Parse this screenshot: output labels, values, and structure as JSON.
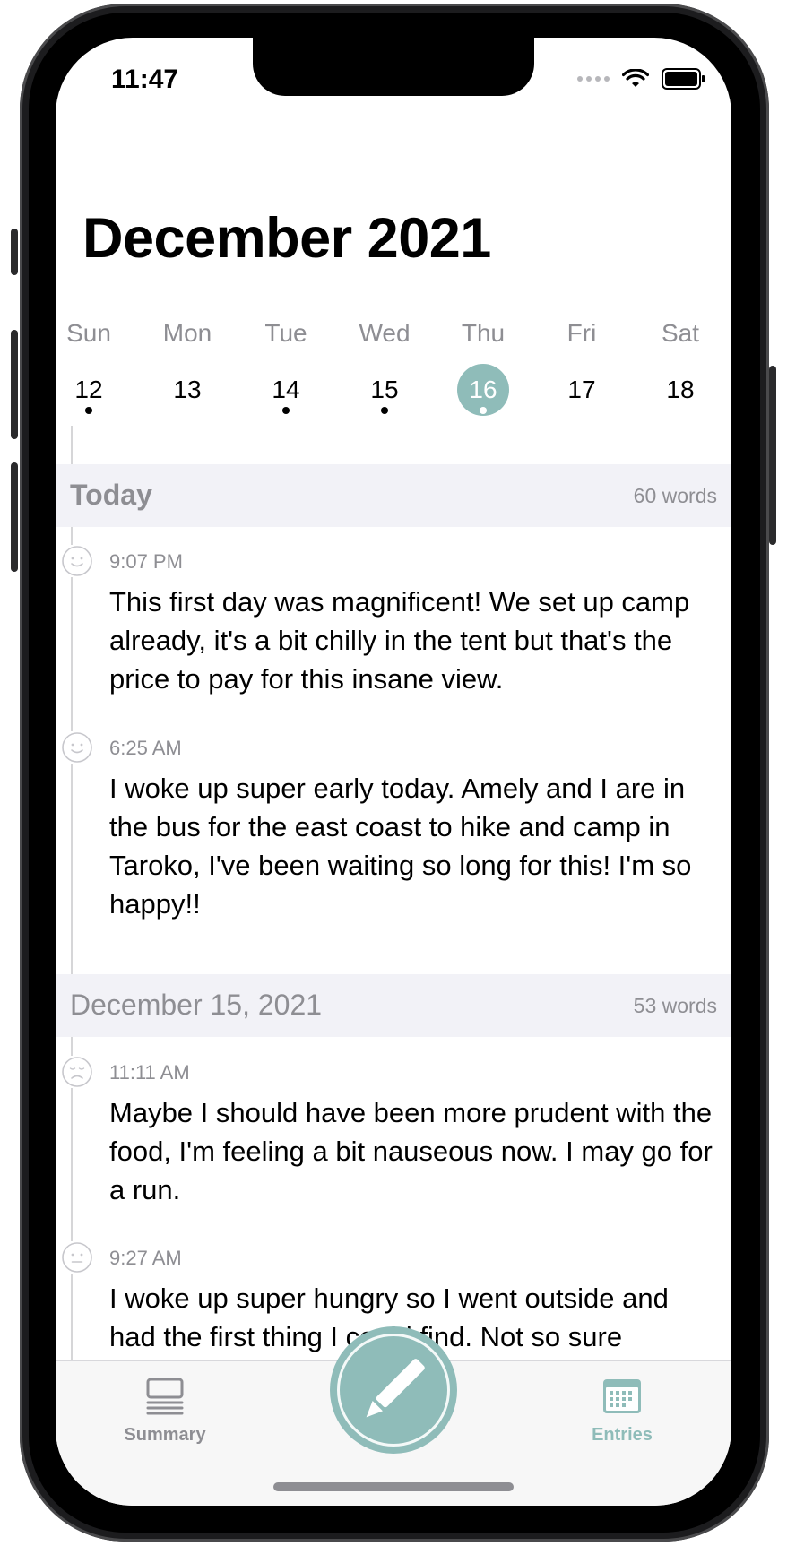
{
  "status_bar": {
    "time": "11:47"
  },
  "header": {
    "title": "December 2021"
  },
  "week": [
    {
      "name": "Sun",
      "num": "12",
      "has_entry": true,
      "selected": false
    },
    {
      "name": "Mon",
      "num": "13",
      "has_entry": false,
      "selected": false
    },
    {
      "name": "Tue",
      "num": "14",
      "has_entry": true,
      "selected": false
    },
    {
      "name": "Wed",
      "num": "15",
      "has_entry": true,
      "selected": false
    },
    {
      "name": "Thu",
      "num": "16",
      "has_entry": true,
      "selected": true
    },
    {
      "name": "Fri",
      "num": "17",
      "has_entry": false,
      "selected": false
    },
    {
      "name": "Sat",
      "num": "18",
      "has_entry": false,
      "selected": false
    }
  ],
  "sections": [
    {
      "title": "Today",
      "words": "60 words",
      "entries": [
        {
          "time": "9:07 PM",
          "mood": "happy-face-icon",
          "text": "This first day was magnificent! We set up camp already, it's a bit chilly in the tent but that's the price to pay for this insane view."
        },
        {
          "time": "6:25 AM",
          "mood": "happy-face-icon",
          "text": "I woke up super early today. Amely and I are in the bus for the east coast to hike and camp in Taroko, I've been waiting so long for this! I'm so happy!!"
        }
      ]
    },
    {
      "title": "December 15, 2021",
      "words": "53 words",
      "entries": [
        {
          "time": "11:11 AM",
          "mood": "sad-face-icon",
          "text": "Maybe I should have been more prudent with the food, I'm feeling a bit nauseous now. I may go for a run."
        },
        {
          "time": "9:27 AM",
          "mood": "neutral-face-icon",
          "text": "I woke up super hungry so I went outside and had the first thing I could find. Not so sure"
        }
      ]
    }
  ],
  "tabbar": {
    "summary_label": "Summary",
    "entries_label": "Entries"
  },
  "colors": {
    "accent": "#8fbcb9",
    "secondary_text": "#8e8e93",
    "section_bg": "#f2f2f7"
  },
  "fab_icon": "pencil-icon"
}
